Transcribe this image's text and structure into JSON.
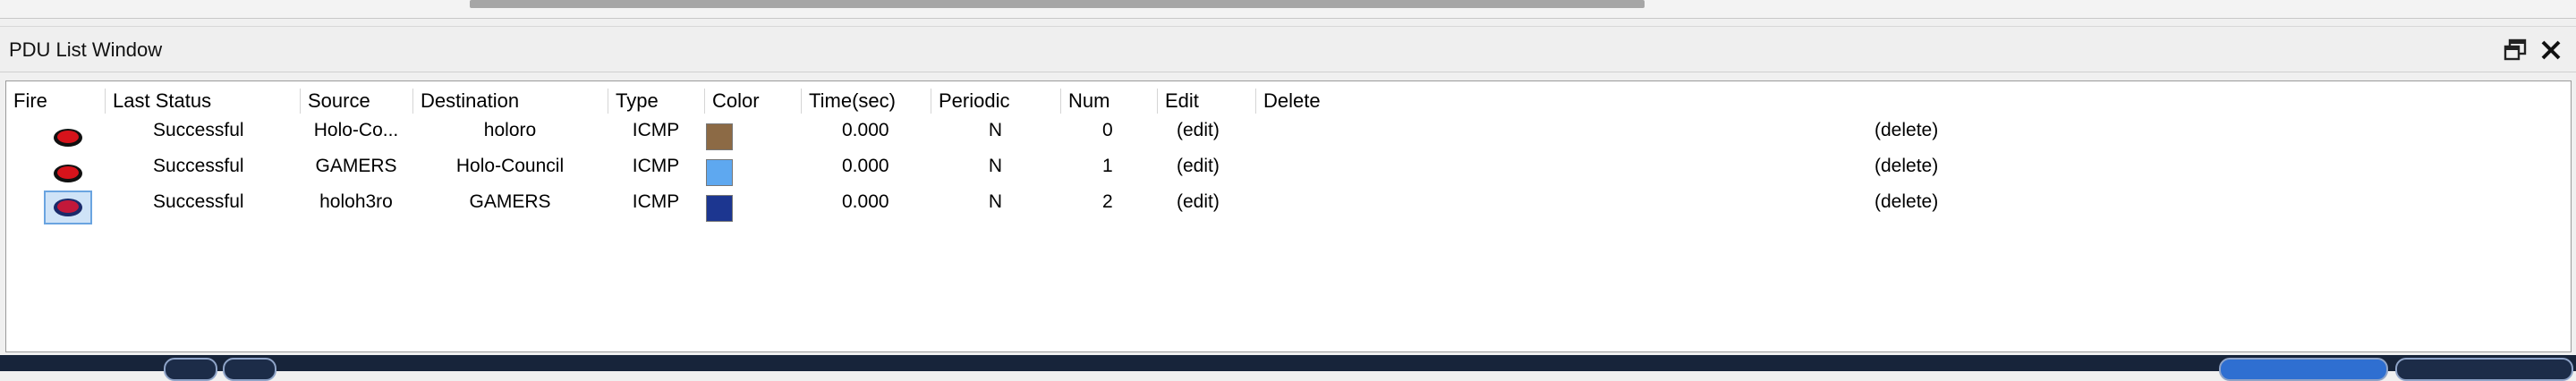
{
  "window": {
    "title": "PDU List Window"
  },
  "columns": [
    "Fire",
    "Last Status",
    "Source",
    "Destination",
    "Type",
    "Color",
    "Time(sec)",
    "Periodic",
    "Num",
    "Edit",
    "Delete"
  ],
  "rows": [
    {
      "last_status": "Successful",
      "source": "Holo-Co...",
      "destination": "holoro",
      "type": "ICMP",
      "color": "#8c6a45",
      "time": "0.000",
      "periodic": "N",
      "num": "0",
      "edit": "(edit)",
      "delete": "(delete)"
    },
    {
      "last_status": "Successful",
      "source": "GAMERS",
      "destination": "Holo-Council",
      "type": "ICMP",
      "color": "#5ea8f0",
      "time": "0.000",
      "periodic": "N",
      "num": "1",
      "edit": "(edit)",
      "delete": "(delete)"
    },
    {
      "last_status": "Successful",
      "source": "holoh3ro",
      "destination": "GAMERS",
      "type": "ICMP",
      "color": "#1c3690",
      "time": "0.000",
      "periodic": "N",
      "num": "2",
      "edit": "(edit)",
      "delete": "(delete)"
    }
  ],
  "icons": {
    "fire": "red-oval-fire-icon",
    "restore": "restore-window-icon",
    "close": "close-icon"
  }
}
